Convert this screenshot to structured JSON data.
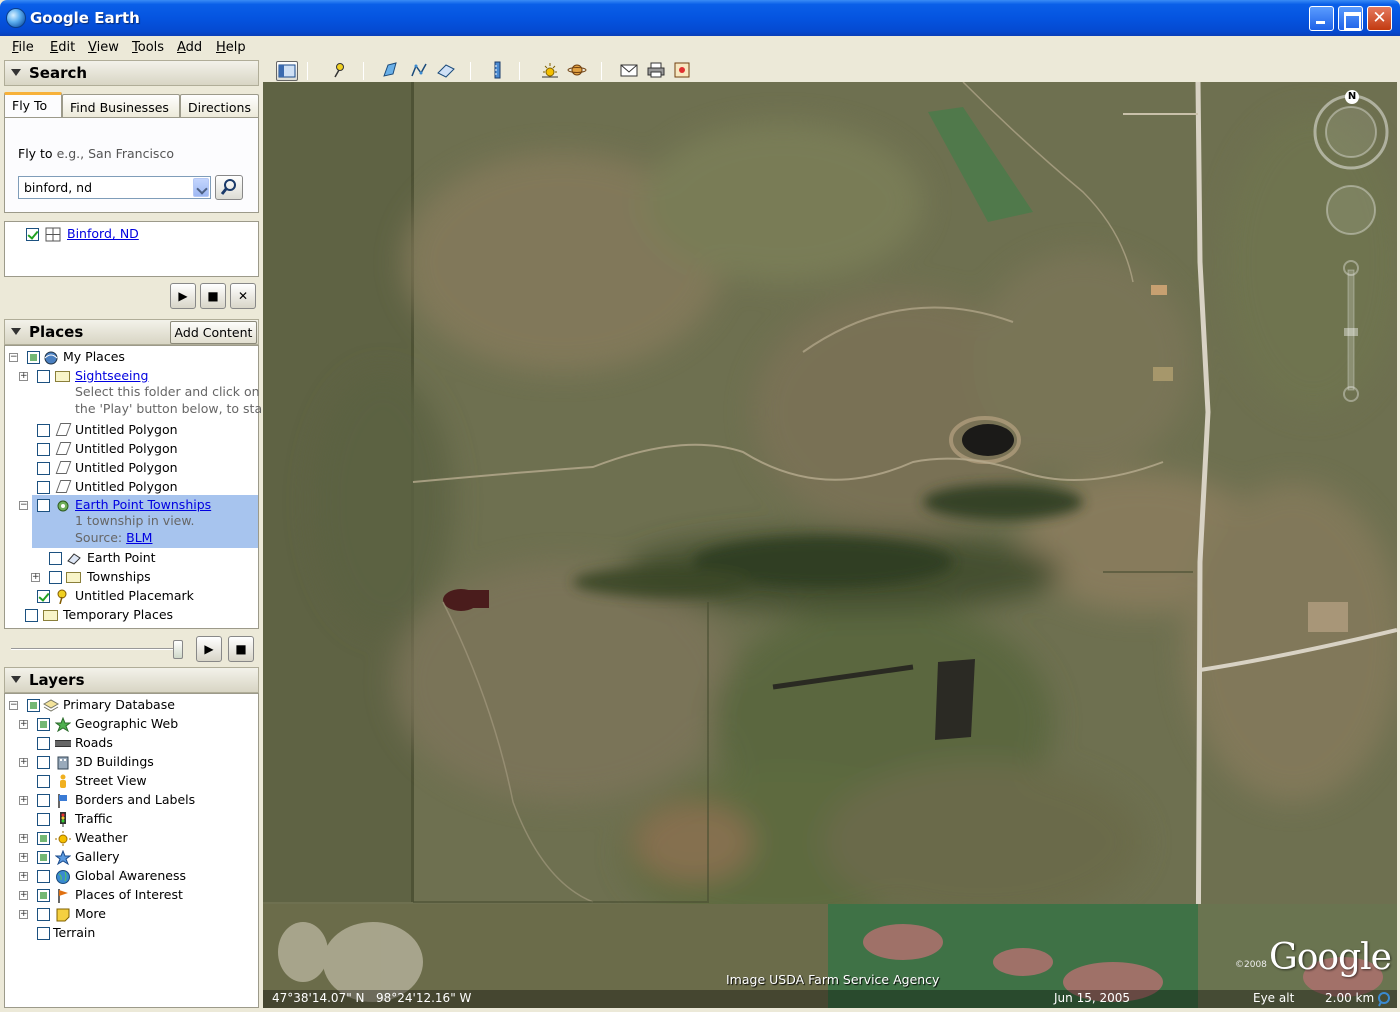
{
  "window": {
    "title": "Google Earth"
  },
  "menu": [
    "File",
    "Edit",
    "View",
    "Tools",
    "Add",
    "Help"
  ],
  "search": {
    "header": "Search",
    "tabs": [
      "Fly To",
      "Find Businesses",
      "Directions"
    ],
    "fly_label": "Fly to",
    "fly_hint": "e.g., San Francisco",
    "input_value": "binford, nd",
    "result": "Binford, ND"
  },
  "places": {
    "header": "Places",
    "add_content": "Add Content",
    "items": {
      "my_places": "My Places",
      "sightseeing": "Sightseeing",
      "sightseeing_desc1": "Select this folder and click on",
      "sightseeing_desc2": "the 'Play' button below, to start",
      "poly1": "Untitled Polygon",
      "poly2": "Untitled Polygon",
      "poly3": "Untitled Polygon",
      "poly4": "Untitled Polygon",
      "epts": "Earth Point Townships",
      "epts_desc": "1 township in view.",
      "epts_source": "Source:",
      "epts_source_link": "BLM",
      "earth_point": "Earth Point",
      "townships": "Townships",
      "placemark": "Untitled Placemark",
      "temporary": "Temporary Places"
    }
  },
  "layers": {
    "header": "Layers",
    "items": {
      "primary": "Primary Database",
      "geoweb": "Geographic Web",
      "roads": "Roads",
      "buildings": "3D Buildings",
      "streetview": "Street View",
      "borders": "Borders and Labels",
      "traffic": "Traffic",
      "weather": "Weather",
      "gallery": "Gallery",
      "global": "Global Awareness",
      "poi": "Places of Interest",
      "more": "More",
      "terrain": "Terrain"
    }
  },
  "map": {
    "attribution": "Image USDA Farm Service Agency",
    "copyright": "©2008",
    "logo": "Google",
    "compass_north": "N",
    "lat": "47°38'14.07\" N",
    "lon": "98°24'12.16\" W",
    "date": "Jun 15, 2005",
    "eye_alt_label": "Eye alt",
    "eye_alt_value": "2.00 km"
  }
}
